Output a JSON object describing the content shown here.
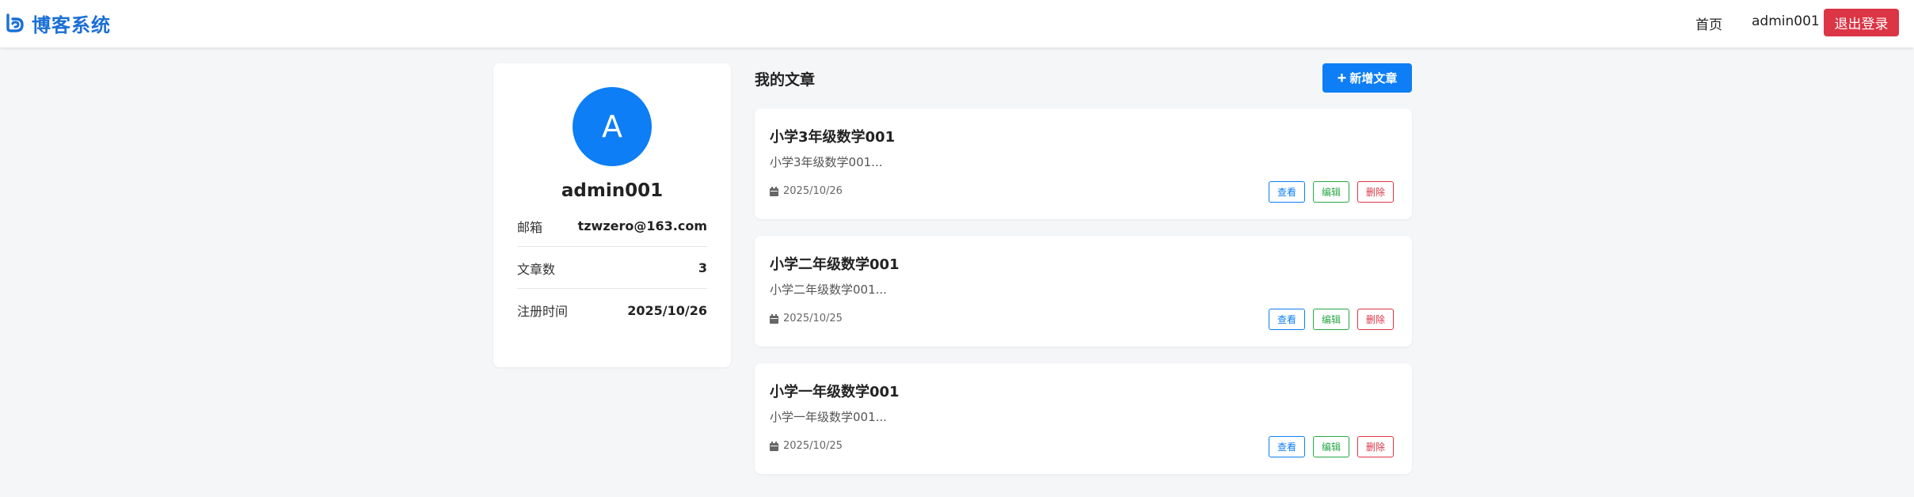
{
  "header": {
    "brand_name": "博客系统",
    "logo_icon": "blog-logo-icon",
    "nav_home": "首页",
    "username": "admin001",
    "logout_label": "退出登录"
  },
  "profile": {
    "avatar_letter": "A",
    "name": "admin001",
    "rows": [
      {
        "label": "邮箱",
        "value": "tzwzero@163.com"
      },
      {
        "label": "文章数",
        "value": "3"
      },
      {
        "label": "注册时间",
        "value": "2025/10/26"
      }
    ]
  },
  "articles_section": {
    "title": "我的文章",
    "new_button_label": "新增文章",
    "new_button_icon": "plus-icon"
  },
  "articles": [
    {
      "title": "小学3年级数学001",
      "summary": "小学3年级数学001...",
      "date": "2025/10/26",
      "view": "查看",
      "edit": "编辑",
      "delete": "删除"
    },
    {
      "title": "小学二年级数学001",
      "summary": "小学二年级数学001...",
      "date": "2025/10/25",
      "view": "查看",
      "edit": "编辑",
      "delete": "删除"
    },
    {
      "title": "小学一年级数学001",
      "summary": "小学一年级数学001...",
      "date": "2025/10/25",
      "view": "查看",
      "edit": "编辑",
      "delete": "删除"
    }
  ],
  "colors": {
    "primary": "#0d7ef5",
    "danger": "#dc3545",
    "success": "#28a745",
    "brand": "#1a6fd6",
    "background": "#f5f6f8"
  }
}
